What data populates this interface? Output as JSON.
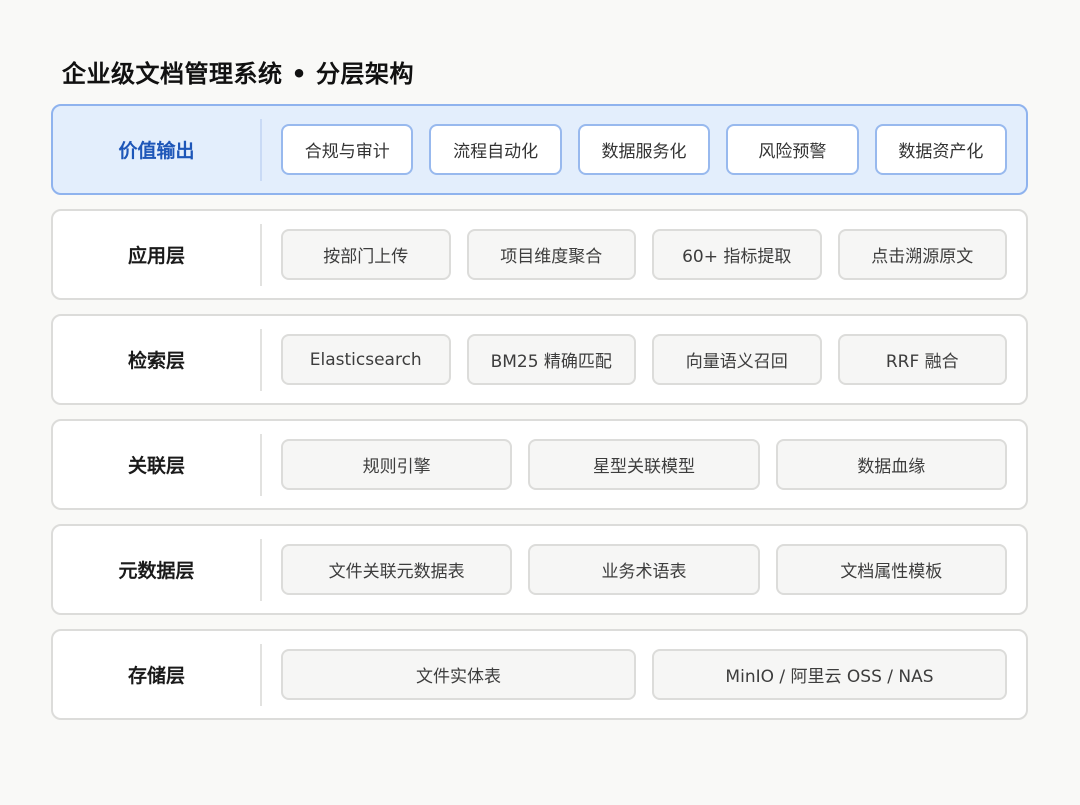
{
  "title": "企业级文档管理系统 • 分层架构",
  "layers": [
    {
      "label": "价值输出",
      "highlight": true,
      "items": [
        "合规与审计",
        "流程自动化",
        "数据服务化",
        "风险预警",
        "数据资产化"
      ]
    },
    {
      "label": "应用层",
      "items": [
        "按部门上传",
        "项目维度聚合",
        "60+ 指标提取",
        "点击溯源原文"
      ]
    },
    {
      "label": "检索层",
      "items": [
        "Elasticsearch",
        "BM25 精确匹配",
        "向量语义召回",
        "RRF 融合"
      ]
    },
    {
      "label": "关联层",
      "items": [
        "规则引擎",
        "星型关联模型",
        "数据血缘"
      ]
    },
    {
      "label": "元数据层",
      "items": [
        "文件关联元数据表",
        "业务术语表",
        "文档属性模板"
      ]
    },
    {
      "label": "存储层",
      "items": [
        "文件实体表",
        "MinIO / 阿里云 OSS / NAS"
      ]
    }
  ],
  "colors": {
    "highlight_background": "#e3eefc",
    "highlight_border": "#8fb3ee",
    "highlight_label": "#1d56b8"
  }
}
